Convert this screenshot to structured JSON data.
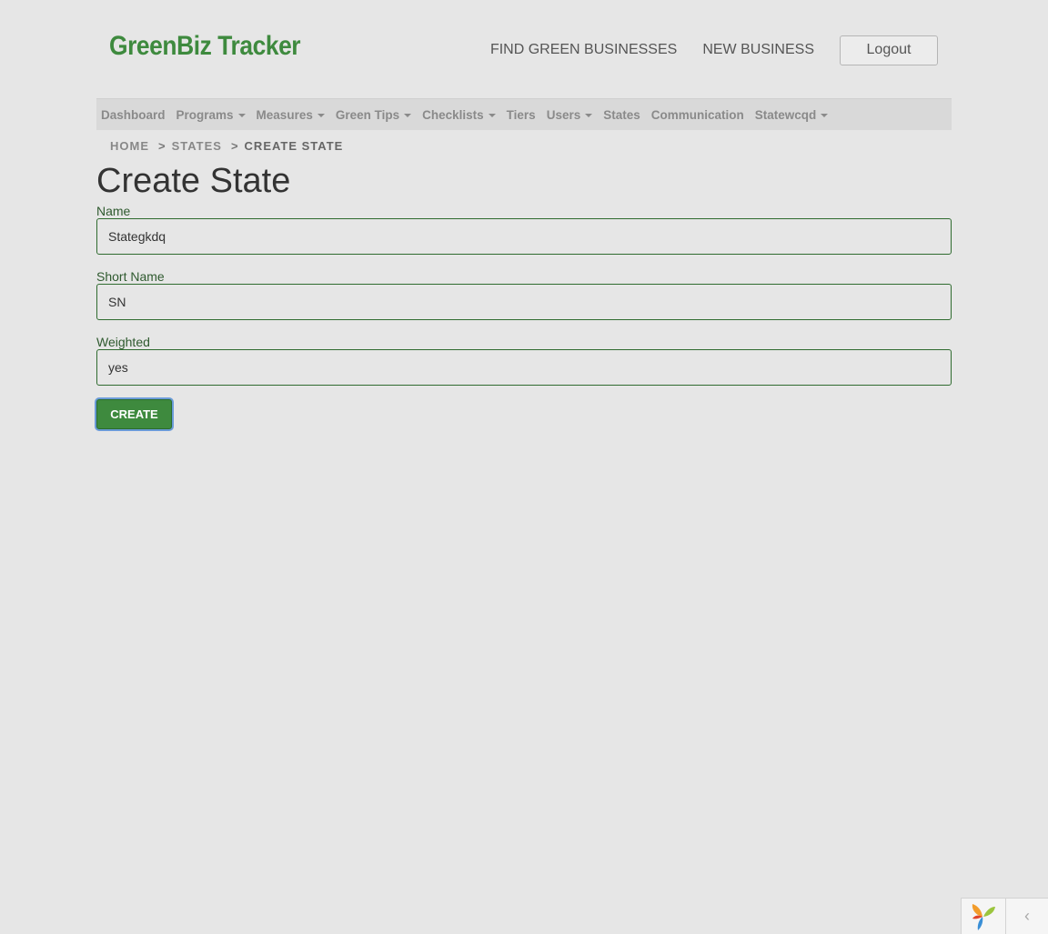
{
  "header": {
    "logo": "GreenBiz Tracker",
    "nav": [
      {
        "label": "FIND GREEN BUSINESSES"
      },
      {
        "label": "NEW BUSINESS"
      }
    ],
    "logout_label": "Logout"
  },
  "menu": {
    "items": [
      {
        "label": "Dashboard",
        "dropdown": false
      },
      {
        "label": "Programs",
        "dropdown": true
      },
      {
        "label": "Measures",
        "dropdown": true
      },
      {
        "label": "Green Tips",
        "dropdown": true
      },
      {
        "label": "Checklists",
        "dropdown": true
      },
      {
        "label": "Tiers",
        "dropdown": false
      },
      {
        "label": "Users",
        "dropdown": true
      },
      {
        "label": "States",
        "dropdown": false
      },
      {
        "label": "Communication",
        "dropdown": false
      },
      {
        "label": "Statewcqd",
        "dropdown": true
      }
    ]
  },
  "breadcrumb": {
    "home": "HOME",
    "states": "STATES",
    "current": "CREATE STATE",
    "separator": ">"
  },
  "page": {
    "title": "Create State"
  },
  "form": {
    "name_label": "Name",
    "name_value": "Stategkdq",
    "short_name_label": "Short Name",
    "short_name_value": "SN",
    "weighted_label": "Weighted",
    "weighted_value": "yes",
    "submit_label": "CREATE"
  },
  "debug_toolbar": {
    "toggle_glyph": "‹"
  },
  "colors": {
    "brand_green": "#3e8a3e",
    "label_green": "#2f5a2f",
    "background": "#e6e6e6"
  }
}
